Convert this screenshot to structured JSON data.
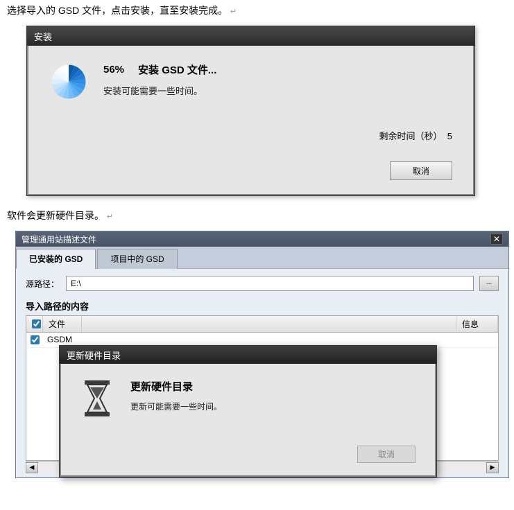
{
  "instruction1": "选择导入的 GSD 文件，点击安装，直至安装完成。",
  "instruction2": "软件会更新硬件目录。",
  "returnMark": "↵",
  "install": {
    "title": "安装",
    "percent": "56%",
    "heading": "安装 GSD 文件...",
    "sub": "安装可能需要一些时间。",
    "remainingLabel": "剩余时间（秒）",
    "remainingValue": "5",
    "cancel": "取消"
  },
  "gsd": {
    "windowTitle": "管理通用站描述文件",
    "tab1": "已安装的 GSD",
    "tab2": "项目中的 GSD",
    "sourceLabel": "源路径：",
    "sourcePath": "E:\\",
    "browse": "...",
    "importSection": "导入路径的内容",
    "colFile": "文件",
    "colInfo": "信息",
    "row1": "GSDM"
  },
  "update": {
    "title": "更新硬件目录",
    "heading": "更新硬件目录",
    "sub": "更新可能需要一些时间。",
    "cancel": "取消"
  }
}
